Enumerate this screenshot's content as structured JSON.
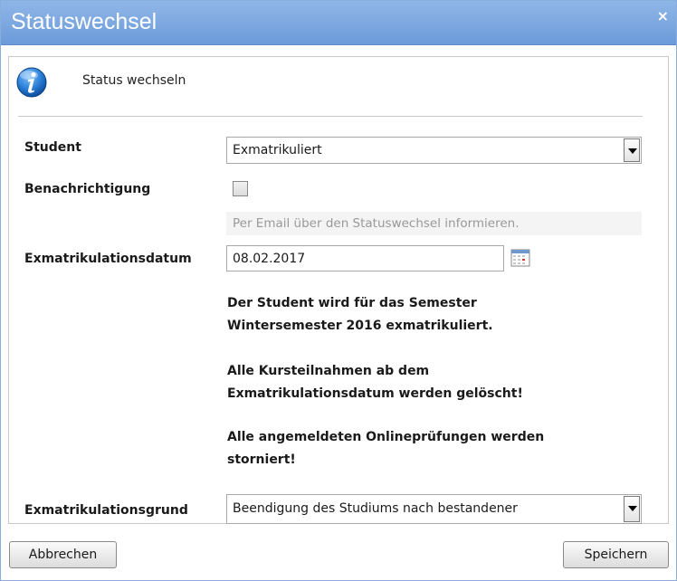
{
  "dialog": {
    "title": "Statuswechsel",
    "close_label": "×"
  },
  "info": {
    "icon": "info-icon",
    "text": "Status wechseln"
  },
  "form": {
    "student_label": "Student",
    "student_value": "Exmatrikuliert",
    "notify_label": "Benachrichtigung",
    "notify_checked": false,
    "notify_hint": "Per Email über den Statuswechsel informieren.",
    "date_label": "Exmatrikulationsdatum",
    "date_value": "08.02.2017",
    "reason_label": "Exmatrikulationsgrund",
    "reason_value": "Beendigung des Studiums nach bestandener"
  },
  "messages": {
    "semester_line1": "Der Student wird für das Semester",
    "semester_line2": "Wintersemester 2016 exmatrikuliert.",
    "courses_line1": "Alle Kursteilnahmen ab dem",
    "courses_line2": "Exmatrikulationsdatum werden gelöscht!",
    "exams_line1": "Alle angemeldeten Onlineprüfungen werden",
    "exams_line2": "storniert!"
  },
  "buttons": {
    "cancel": "Abbrechen",
    "save": "Speichern"
  },
  "colors": {
    "titlebar": "#7aa6e0",
    "title_text": "#ffffff",
    "info_blue": "#1f6fc4"
  }
}
